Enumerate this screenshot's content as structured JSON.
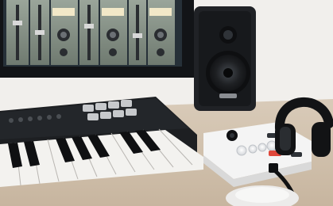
{
  "photo": {
    "colors": {
      "background": "#f1efec",
      "desk": "#cdbca7",
      "monitor_bezel": "#121417",
      "screen_plugin": "#8a9587",
      "speaker_body": "#202226",
      "speaker_cone": "#1b1c1f",
      "keyboard_body": "#1d1f22",
      "white_keys": "#f3f2ef",
      "black_keys": "#0f1012",
      "interface_body": "#f4f4f4",
      "headphones": "#121315",
      "mouse": "#ecebea",
      "accent_red": "#e0473a"
    },
    "icons": [
      "monitor-icon",
      "speaker-icon",
      "midi-keyboard-icon",
      "audio-interface-icon",
      "headphones-icon",
      "mouse-icon",
      "cable-icon"
    ]
  }
}
